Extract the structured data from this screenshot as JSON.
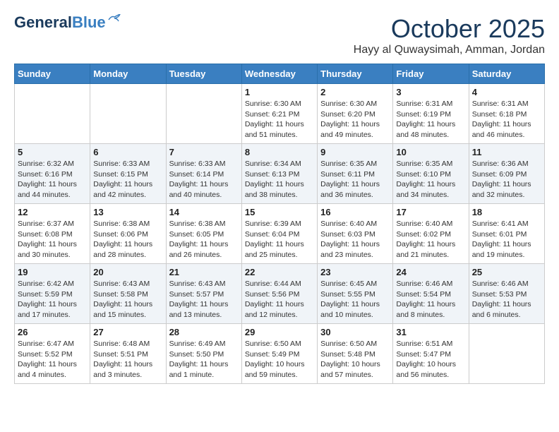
{
  "logo": {
    "line1": "General",
    "line2": "Blue"
  },
  "title": "October 2025",
  "subtitle": "Hayy al Quwaysimah, Amman, Jordan",
  "days_of_week": [
    "Sunday",
    "Monday",
    "Tuesday",
    "Wednesday",
    "Thursday",
    "Friday",
    "Saturday"
  ],
  "weeks": [
    [
      {
        "day": "",
        "info": ""
      },
      {
        "day": "",
        "info": ""
      },
      {
        "day": "",
        "info": ""
      },
      {
        "day": "1",
        "info": "Sunrise: 6:30 AM\nSunset: 6:21 PM\nDaylight: 11 hours\nand 51 minutes."
      },
      {
        "day": "2",
        "info": "Sunrise: 6:30 AM\nSunset: 6:20 PM\nDaylight: 11 hours\nand 49 minutes."
      },
      {
        "day": "3",
        "info": "Sunrise: 6:31 AM\nSunset: 6:19 PM\nDaylight: 11 hours\nand 48 minutes."
      },
      {
        "day": "4",
        "info": "Sunrise: 6:31 AM\nSunset: 6:18 PM\nDaylight: 11 hours\nand 46 minutes."
      }
    ],
    [
      {
        "day": "5",
        "info": "Sunrise: 6:32 AM\nSunset: 6:16 PM\nDaylight: 11 hours\nand 44 minutes."
      },
      {
        "day": "6",
        "info": "Sunrise: 6:33 AM\nSunset: 6:15 PM\nDaylight: 11 hours\nand 42 minutes."
      },
      {
        "day": "7",
        "info": "Sunrise: 6:33 AM\nSunset: 6:14 PM\nDaylight: 11 hours\nand 40 minutes."
      },
      {
        "day": "8",
        "info": "Sunrise: 6:34 AM\nSunset: 6:13 PM\nDaylight: 11 hours\nand 38 minutes."
      },
      {
        "day": "9",
        "info": "Sunrise: 6:35 AM\nSunset: 6:11 PM\nDaylight: 11 hours\nand 36 minutes."
      },
      {
        "day": "10",
        "info": "Sunrise: 6:35 AM\nSunset: 6:10 PM\nDaylight: 11 hours\nand 34 minutes."
      },
      {
        "day": "11",
        "info": "Sunrise: 6:36 AM\nSunset: 6:09 PM\nDaylight: 11 hours\nand 32 minutes."
      }
    ],
    [
      {
        "day": "12",
        "info": "Sunrise: 6:37 AM\nSunset: 6:08 PM\nDaylight: 11 hours\nand 30 minutes."
      },
      {
        "day": "13",
        "info": "Sunrise: 6:38 AM\nSunset: 6:06 PM\nDaylight: 11 hours\nand 28 minutes."
      },
      {
        "day": "14",
        "info": "Sunrise: 6:38 AM\nSunset: 6:05 PM\nDaylight: 11 hours\nand 26 minutes."
      },
      {
        "day": "15",
        "info": "Sunrise: 6:39 AM\nSunset: 6:04 PM\nDaylight: 11 hours\nand 25 minutes."
      },
      {
        "day": "16",
        "info": "Sunrise: 6:40 AM\nSunset: 6:03 PM\nDaylight: 11 hours\nand 23 minutes."
      },
      {
        "day": "17",
        "info": "Sunrise: 6:40 AM\nSunset: 6:02 PM\nDaylight: 11 hours\nand 21 minutes."
      },
      {
        "day": "18",
        "info": "Sunrise: 6:41 AM\nSunset: 6:01 PM\nDaylight: 11 hours\nand 19 minutes."
      }
    ],
    [
      {
        "day": "19",
        "info": "Sunrise: 6:42 AM\nSunset: 5:59 PM\nDaylight: 11 hours\nand 17 minutes."
      },
      {
        "day": "20",
        "info": "Sunrise: 6:43 AM\nSunset: 5:58 PM\nDaylight: 11 hours\nand 15 minutes."
      },
      {
        "day": "21",
        "info": "Sunrise: 6:43 AM\nSunset: 5:57 PM\nDaylight: 11 hours\nand 13 minutes."
      },
      {
        "day": "22",
        "info": "Sunrise: 6:44 AM\nSunset: 5:56 PM\nDaylight: 11 hours\nand 12 minutes."
      },
      {
        "day": "23",
        "info": "Sunrise: 6:45 AM\nSunset: 5:55 PM\nDaylight: 11 hours\nand 10 minutes."
      },
      {
        "day": "24",
        "info": "Sunrise: 6:46 AM\nSunset: 5:54 PM\nDaylight: 11 hours\nand 8 minutes."
      },
      {
        "day": "25",
        "info": "Sunrise: 6:46 AM\nSunset: 5:53 PM\nDaylight: 11 hours\nand 6 minutes."
      }
    ],
    [
      {
        "day": "26",
        "info": "Sunrise: 6:47 AM\nSunset: 5:52 PM\nDaylight: 11 hours\nand 4 minutes."
      },
      {
        "day": "27",
        "info": "Sunrise: 6:48 AM\nSunset: 5:51 PM\nDaylight: 11 hours\nand 3 minutes."
      },
      {
        "day": "28",
        "info": "Sunrise: 6:49 AM\nSunset: 5:50 PM\nDaylight: 11 hours\nand 1 minute."
      },
      {
        "day": "29",
        "info": "Sunrise: 6:50 AM\nSunset: 5:49 PM\nDaylight: 10 hours\nand 59 minutes."
      },
      {
        "day": "30",
        "info": "Sunrise: 6:50 AM\nSunset: 5:48 PM\nDaylight: 10 hours\nand 57 minutes."
      },
      {
        "day": "31",
        "info": "Sunrise: 6:51 AM\nSunset: 5:47 PM\nDaylight: 10 hours\nand 56 minutes."
      },
      {
        "day": "",
        "info": ""
      }
    ]
  ]
}
